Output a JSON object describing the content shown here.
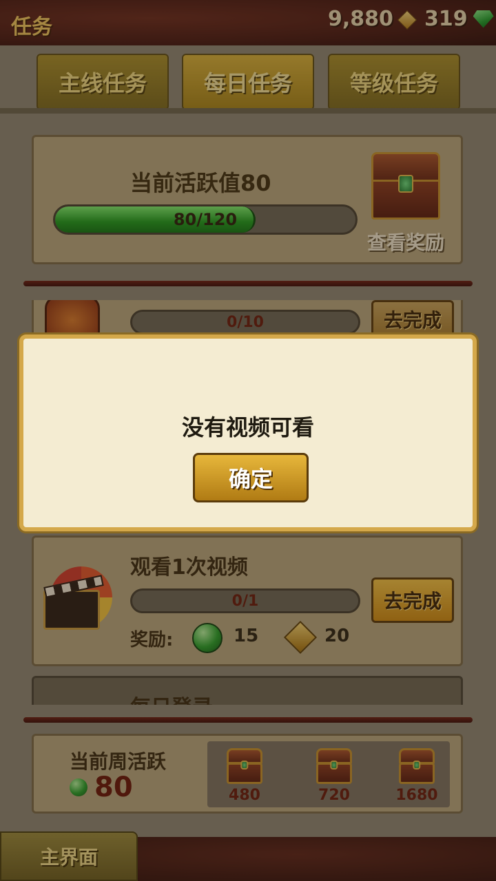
{
  "header": {
    "title": "任务",
    "gold": "9,880",
    "gems": "319"
  },
  "tabs": [
    {
      "label": "主线任务",
      "active": false
    },
    {
      "label": "每日任务",
      "active": true
    },
    {
      "label": "等级任务",
      "active": false
    }
  ],
  "activity": {
    "title": "当前活跃值80",
    "progress_text": "80/120",
    "progress_value": 80,
    "progress_max": 120,
    "view_reward": "查看奖励"
  },
  "partial_task": {
    "progress_text": "0/10",
    "button": "去完成"
  },
  "dialog": {
    "message": "没有视频可看",
    "ok": "确定"
  },
  "video_task": {
    "title": "观看1次视频",
    "progress_text": "0/1",
    "button": "去完成",
    "reward_label": "奖励:",
    "reward_gem": "15",
    "reward_gold": "20"
  },
  "login_task": {
    "title": "每日登录"
  },
  "weekly": {
    "label": "当前周活跃",
    "value": "80",
    "milestones": [
      "480",
      "720",
      "1680"
    ]
  },
  "footer": {
    "home": "主界面"
  },
  "colors": {
    "progress_green": "#1f9a1c",
    "button_gold": "#e7b73b",
    "accent_red": "#6a1608"
  }
}
